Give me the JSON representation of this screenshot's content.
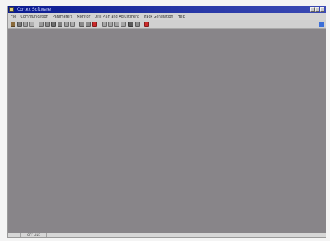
{
  "window": {
    "title": "Cortex Software"
  },
  "menubar": {
    "items": [
      "File",
      "Communication",
      "Parameters",
      "Monitor",
      "Drill Plan and Adjustment",
      "Track Generation",
      "Help"
    ]
  },
  "toolbar": {
    "icons": [
      "open-icon",
      "save-icon",
      "print-icon",
      "cut-icon",
      "copy-icon",
      "paste-icon",
      "tool-icon",
      "tool-icon",
      "tool-icon",
      "tool-icon",
      "zoom-icon",
      "zoom-icon",
      "stop-icon",
      "arrow-icon",
      "arrow-icon",
      "arrow-icon",
      "arrow-icon",
      "record-icon",
      "chart-icon",
      "alarm-icon",
      "help-icon"
    ],
    "colors": {
      "accent_blue": "#3c6fd8",
      "alert_red": "#cc2b2b",
      "neutral": "#6a6a6a"
    }
  },
  "statusbar": {
    "panel_text": "OFF LINE"
  }
}
